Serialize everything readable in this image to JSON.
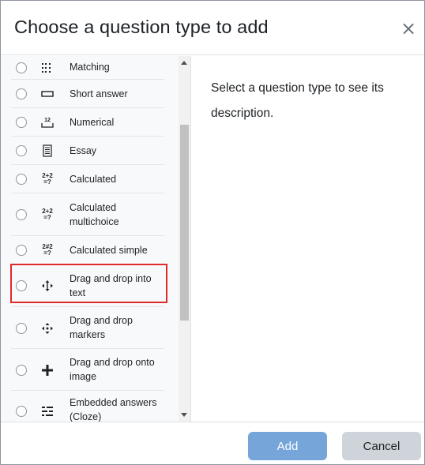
{
  "dialog": {
    "title": "Choose a question type to add",
    "close_glyph": "×",
    "description": "Select a question type to see its description.",
    "add_label": "Add",
    "cancel_label": "Cancel"
  },
  "options": [
    {
      "label": "Matching",
      "icon": "matching-icon",
      "selected": false
    },
    {
      "label": "Short answer",
      "icon": "short-answer-icon",
      "selected": false
    },
    {
      "label": "Numerical",
      "icon": "numerical-icon",
      "selected": false
    },
    {
      "label": "Essay",
      "icon": "essay-icon",
      "selected": false
    },
    {
      "label": "Calculated",
      "icon": "calculated-icon",
      "selected": false
    },
    {
      "label": "Calculated multichoice",
      "icon": "calculated-multichoice-icon",
      "selected": false
    },
    {
      "label": "Calculated simple",
      "icon": "calculated-simple-icon",
      "selected": false
    },
    {
      "label": "Drag and drop into text",
      "icon": "drag-drop-text-icon",
      "selected": false
    },
    {
      "label": "Drag and drop markers",
      "icon": "drag-drop-markers-icon",
      "selected": false
    },
    {
      "label": "Drag and drop onto image",
      "icon": "drag-drop-image-icon",
      "selected": false
    },
    {
      "label": "Embedded answers (Cloze)",
      "icon": "cloze-icon",
      "selected": false
    }
  ],
  "icon_text": {
    "numerical": "12",
    "calc_top": "2+2",
    "calc_bottom": "=?",
    "calc_simple_top": "2#2",
    "calc_simple_bottom": "=?"
  },
  "colors": {
    "add_button": "#75a5d9",
    "cancel_button": "#ced4da",
    "highlight_border": "#e02a2a"
  }
}
